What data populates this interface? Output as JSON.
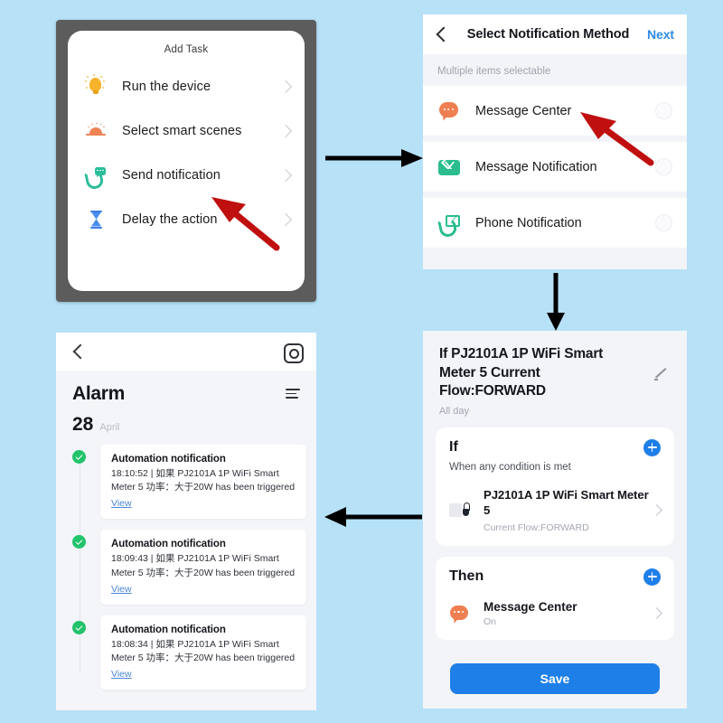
{
  "background_color": "#b6e1f7",
  "panel_add_task": {
    "title": "Add Task",
    "items": [
      {
        "icon": "lightbulb-icon",
        "label": "Run the device"
      },
      {
        "icon": "smart-scene-icon",
        "label": "Select smart scenes"
      },
      {
        "icon": "phone-message-icon",
        "label": "Send notification"
      },
      {
        "icon": "hourglass-icon",
        "label": "Delay the action"
      }
    ]
  },
  "panel_notify_method": {
    "back_icon": "back-chevron-icon",
    "title": "Select Notification Method",
    "next_label": "Next",
    "next_color": "#2e8be6",
    "subtitle": "Multiple items selectable",
    "items": [
      {
        "icon": "chat-bubble-icon",
        "label": "Message Center",
        "selected": false
      },
      {
        "icon": "envelope-icon",
        "label": "Message Notification",
        "selected": false
      },
      {
        "icon": "phone-envelope-icon",
        "label": "Phone Notification",
        "selected": false
      }
    ]
  },
  "panel_rule": {
    "title": "If PJ2101A 1P WiFi Smart Meter  5 Current Flow:FORWARD",
    "schedule": "All day",
    "edit_icon": "pencil-icon",
    "if_card": {
      "heading": "If",
      "add_icon": "plus-icon",
      "subtitle": "When any condition is met",
      "device_name": "PJ2101A 1P WiFi Smart Meter 5",
      "device_meta": "Current Flow:FORWARD",
      "chevron_icon": "chevron-right-icon"
    },
    "then_card": {
      "heading": "Then",
      "add_icon": "plus-icon",
      "action_name": "Message Center",
      "action_meta": "On",
      "chevron_icon": "chevron-right-icon"
    },
    "save_label": "Save",
    "save_color": "#1f7fe8"
  },
  "panel_alarm": {
    "back_icon": "back-chevron-icon",
    "settings_icon": "gear-icon",
    "title": "Alarm",
    "filter_icon": "filter-list-icon",
    "date_day": "28",
    "date_month": "April",
    "notifications": [
      {
        "status_icon": "check-circle-icon",
        "heading": "Automation notification",
        "body": "18:10:52 | 如果 PJ2101A 1P WiFi Smart Meter  5 功率：大于20W has been triggered",
        "link": "View"
      },
      {
        "status_icon": "check-circle-icon",
        "heading": "Automation notification",
        "body": "18:09:43 | 如果 PJ2101A 1P WiFi Smart Meter  5 功率：大于20W has been triggered",
        "link": "View"
      },
      {
        "status_icon": "check-circle-icon",
        "heading": "Automation notification",
        "body": "18:08:34 | 如果 PJ2101A 1P WiFi Smart Meter  5 功率：大于20W has been triggered",
        "link": "View"
      }
    ]
  },
  "annotations": {
    "flow_arrows": [
      {
        "name": "arrow-add-task-to-notify-method",
        "direction": "right",
        "color": "#000000"
      },
      {
        "name": "arrow-notify-method-to-rule",
        "direction": "down",
        "color": "#000000"
      },
      {
        "name": "arrow-rule-to-alarm",
        "direction": "left",
        "color": "#000000"
      }
    ],
    "callout_arrows": [
      {
        "name": "red-arrow-send-notification",
        "color": "#c00f0f"
      },
      {
        "name": "red-arrow-message-center",
        "color": "#c00f0f"
      }
    ]
  }
}
